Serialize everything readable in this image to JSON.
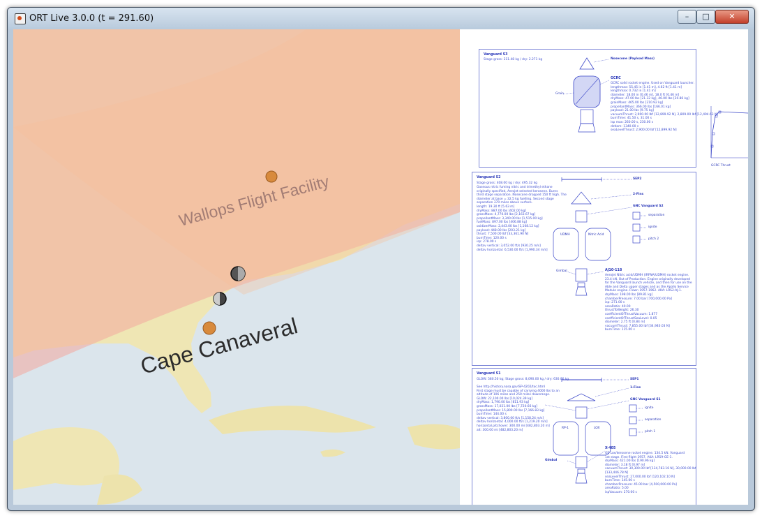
{
  "window": {
    "title": "ORT Live 3.0.0 (t = 291.60)",
    "min_glyph": "–",
    "max_glyph": "□",
    "close_glyph": "✕"
  },
  "map": {
    "labels": {
      "wallops": "Wallops Flight Facility",
      "cape": "Cape Canaveral"
    },
    "colors": {
      "ocean": "#d9e6ef",
      "land": "#f0e8b4",
      "zone_red": "#f3c9c6",
      "zone_orange": "#f5c9a8"
    }
  },
  "panels": {
    "s3": {
      "title": "Vanguard S3",
      "mass": "Stage gross: 211.48 kg / dry: 2.271 kg",
      "nose_label": "Nosecone (Payload Mass)",
      "engine_label": "Grain",
      "motor_title": "GCRC",
      "motor_lines": "GCRC solid rocket engine. Used on Vanguard launcher.\nlengthmax: 55.45 in [1.41 m], 4.62 ft [1.41 m]\nlengthmax: 0.732 in [1.41 m]\ndiameter: 18.00 in [0.46 m], 18.0 ft [0.46 m]\ndryMass: 47.00 lbs [21.32 kg], 46.00 lbs [20.86 kg]\ngrainMass: 465.00 lbs [210.92 kg]\npropellantMass: 366.00 lbs [166.01 kg]\npayload: 21.00 lbs [9.75 kg]\nvacuumThrust: 2,900.00 lbf [12,899.92 N], 2,809.00 lbf [12,494.63 N]\nburnTime: 41.50 s, 31.00 s\nisp max: 260.00 s, 230.00 s\ndetlam: 1340.00 s\nseaLevelThrust: 2,900.00 lbf [12,899.92 N]"
    },
    "thrust_label": "GCRC Thrust",
    "s2": {
      "title": "Vanguard S2",
      "mass": "Stage gross: 408.00 kg / dry: 495.32 kg",
      "lines": "Gaseous nitric fuming nitric and trimethyl ethane\noriginally specified, Aerojet selected kerosene. Burns\nthird stage separation. Nosecone dropped 150 ft high. The\ndiameter at base = 32.5 kg fuelling. Second stage\nseparation 370 miles above surface.\nlength: 19.30 ft [5.63 m]\ndryMass: 887.00 lbs [402.00 kg]\ngrossMass: 4,770.00 lbs [2,163.67 kg]\npropellantMass: 3,340.00 lbs [1,515.00 kg]\nfuelMass: 897.00 lbs [406.88 kg]\noxidizerMass: 2,443.00 lbs [1,108.12 kg]\npayload: 448.00 lbs [203.21 kg]\nthrust: 7,500.00 lbf [33,361.90 N]\nburnTime: 120.00 s\nisp: 278.00 s\ndeltav vertical: 3,052.00 ft/s [930.25 m/s]\ndeltav horizontal: 6,530.00 ft/s [1,990.34 m/s]",
      "sep": "SEP2",
      "fins": "2-Fins",
      "guidance": "GNC Vanguard S2",
      "sub1": "separation",
      "sub2": "ignite",
      "sub3": "pitch 2",
      "tank1": "UDMH",
      "tank2": "Nitric Acid",
      "gimbal": "Gimbal",
      "engine_title": "AJ10-118",
      "engine_lines": "Aerojet Nitric acid/UDMH (IRFNA/UDMH) rocket engine.\n23.4 kN. Out of Production. Engine originally developed\nfor the Vanguard launch vehicle, and then for use on the\nAble and Delta upper stages and as the Apollo Service\nModule engine. Flown 1957-1962. AKA: LRS2-AJ-1.\ndryMass: 198.00 lbs [89.81 kg]\nchamberPressure: 7.00 bar [700,000.00 Pa]\nisp: 271.00 s\nareaRatio: 40.00\nthrustToWeight: 26.30\ncoefficientOfThrustVacuum: 1.877\ncoefficientOfThrustSeaLevel: 0.05\ndiameter: 2.75 ft [0.84 m]\nvacuumThrust: 7,855.00 lbf [34,940.03 N]\nburnTime: 115.00 s"
    },
    "s1": {
      "title": "Vanguard S1",
      "mass": "GLOW: 580.50 kg; Stage gross: 8,090.00 kg / dry: 630.00 kg",
      "lines": "See http://history.nasa.gov/SP-4202/toc.html\nFirst stage must be capable of carrying 4000 lbs to an\naltitude of 106 miles and 250 miles downrange.\nGLOW: 22,100.00 lbs [10,024.39 kg]\ndryMass: 1,790.00 lbs [811.93 kg]\ngrossMass: 17,021.00 lbs [7,720.66 kg]\npropellantMass: 15,800.00 lbs [7,166.83 kg]\nburnTime: 144.00 s\ndeltav vertical: 3,800.00 ft/s [1,158.24 m/s]\ndeltav horizontal: 4,000.00 ft/s [1,219.20 m/s]\nhorizontal.pitchover: 300.00 mi [482,803.20 m]\nalt: 300.00 mi [482,803.20 m]",
      "sep": "SEP1",
      "fins": "1-Fins",
      "guidance": "GNC Vanguard S1",
      "sub1": "ignite",
      "sub2": "separation",
      "sub3": "pitch 1",
      "tank1": "RP-1",
      "tank2": "LOX",
      "gimbal": "Gimbal",
      "engine_title": "X-405",
      "engine_lines": "GE Lox/kerosene rocket engine. 134.5 kN. Vanguard\n1st stage. First flight 1957. AKA: LR59-GE-1.\ndryMass: 421.00 lbs [190.96 kg]\ndiameter: 3.18 ft [0.97 m]\nvacuumThrust: 30,300.00 lbf [134,783.16 N], 30,000.00 lbf\n[133,446.78 N]\nseaLevelThrust: 27,000.00 lbf [120,102.10 N]\nburnTime: 145.00 s\nchamberPressure: 45.00 bar [4,500,000.00 Pa]\nareaRatio: 5.00\nispVacuum: 270.00 s"
    }
  }
}
